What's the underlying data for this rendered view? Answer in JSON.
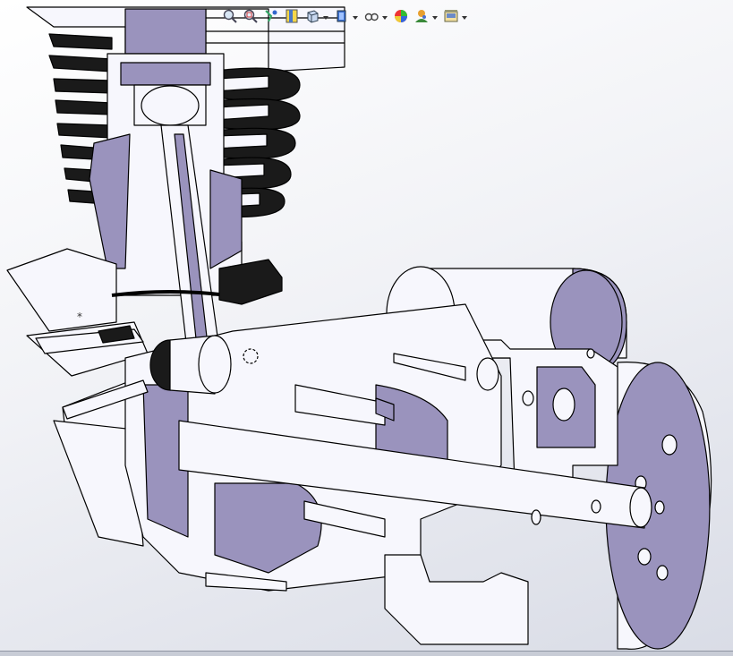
{
  "window": {
    "viewport": "graphics-area",
    "background_top": "#ffffff",
    "background_bottom": "#d9dce6"
  },
  "toolbar": {
    "items": [
      {
        "icon": "zoom-to-fit-icon",
        "dropdown": false
      },
      {
        "icon": "zoom-to-area-icon",
        "dropdown": false
      },
      {
        "icon": "previous-view-icon",
        "dropdown": false
      },
      {
        "icon": "section-view-icon",
        "dropdown": false
      },
      {
        "icon": "view-orientation-icon",
        "dropdown": false
      },
      {
        "icon": "display-style-icon",
        "dropdown": true
      },
      {
        "icon": "hide-show-items-icon",
        "dropdown": true
      },
      {
        "icon": "edit-appearance-icon",
        "dropdown": false
      },
      {
        "icon": "apply-scene-icon",
        "dropdown": true
      },
      {
        "icon": "view-settings-icon",
        "dropdown": true
      }
    ]
  },
  "model": {
    "part_fill": "#f7f7fd",
    "section_fill": "#9a93bd",
    "edge_color": "#000000",
    "shadow_fill": "#1a1a1a"
  }
}
